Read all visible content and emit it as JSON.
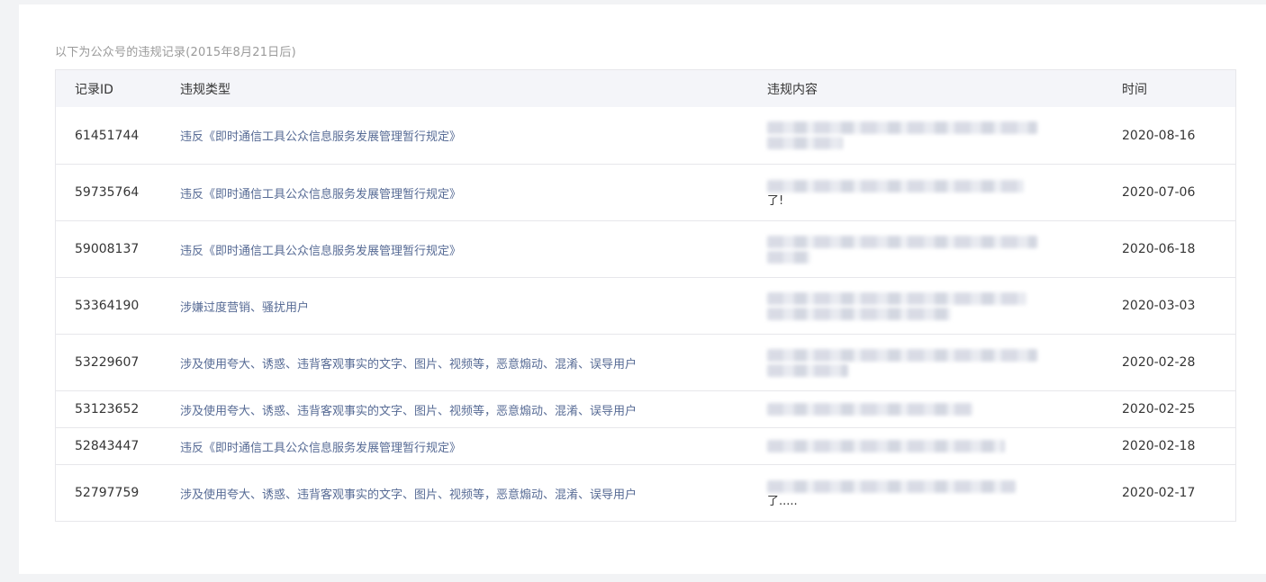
{
  "notice": "以下为公众号的违规记录(2015年8月21日后)",
  "table": {
    "headers": {
      "id": "记录ID",
      "type": "违规类型",
      "content": "违规内容",
      "time": "时间"
    },
    "rows": [
      {
        "id": "61451744",
        "type": "违反《即时通信工具公众信息服务发展管理暂行规定》",
        "content_tail": "",
        "time": "2020-08-16",
        "lines": [
          1,
          0.28
        ]
      },
      {
        "id": "59735764",
        "type": "违反《即时通信工具公众信息服务发展管理暂行规定》",
        "content_tail": "了!",
        "time": "2020-07-06",
        "lines": [
          0.95
        ]
      },
      {
        "id": "59008137",
        "type": "违反《即时通信工具公众信息服务发展管理暂行规定》",
        "content_tail": "",
        "time": "2020-06-18",
        "lines": [
          1,
          0.16
        ]
      },
      {
        "id": "53364190",
        "type": "涉嫌过度营销、骚扰用户",
        "content_tail": "",
        "time": "2020-03-03",
        "lines": [
          0.96,
          0.68
        ]
      },
      {
        "id": "53229607",
        "type": "涉及使用夸大、诱惑、违背客观事实的文字、图片、视频等，恶意煽动、混淆、误导用户",
        "content_tail": "",
        "time": "2020-02-28",
        "lines": [
          1,
          0.3
        ]
      },
      {
        "id": "53123652",
        "type": "涉及使用夸大、诱惑、违背客观事实的文字、图片、视频等，恶意煽动、混淆、误导用户",
        "content_tail": "",
        "time": "2020-02-25",
        "lines": [
          0.76
        ]
      },
      {
        "id": "52843447",
        "type": "违反《即时通信工具公众信息服务发展管理暂行规定》",
        "content_tail": "",
        "time": "2020-02-18",
        "lines": [
          0.88
        ]
      },
      {
        "id": "52797759",
        "type": "涉及使用夸大、诱惑、违背客观事实的文字、图片、视频等，恶意煽动、混淆、误导用户",
        "content_tail": "了.....",
        "time": "2020-02-17",
        "lines": [
          0.92
        ]
      }
    ]
  }
}
